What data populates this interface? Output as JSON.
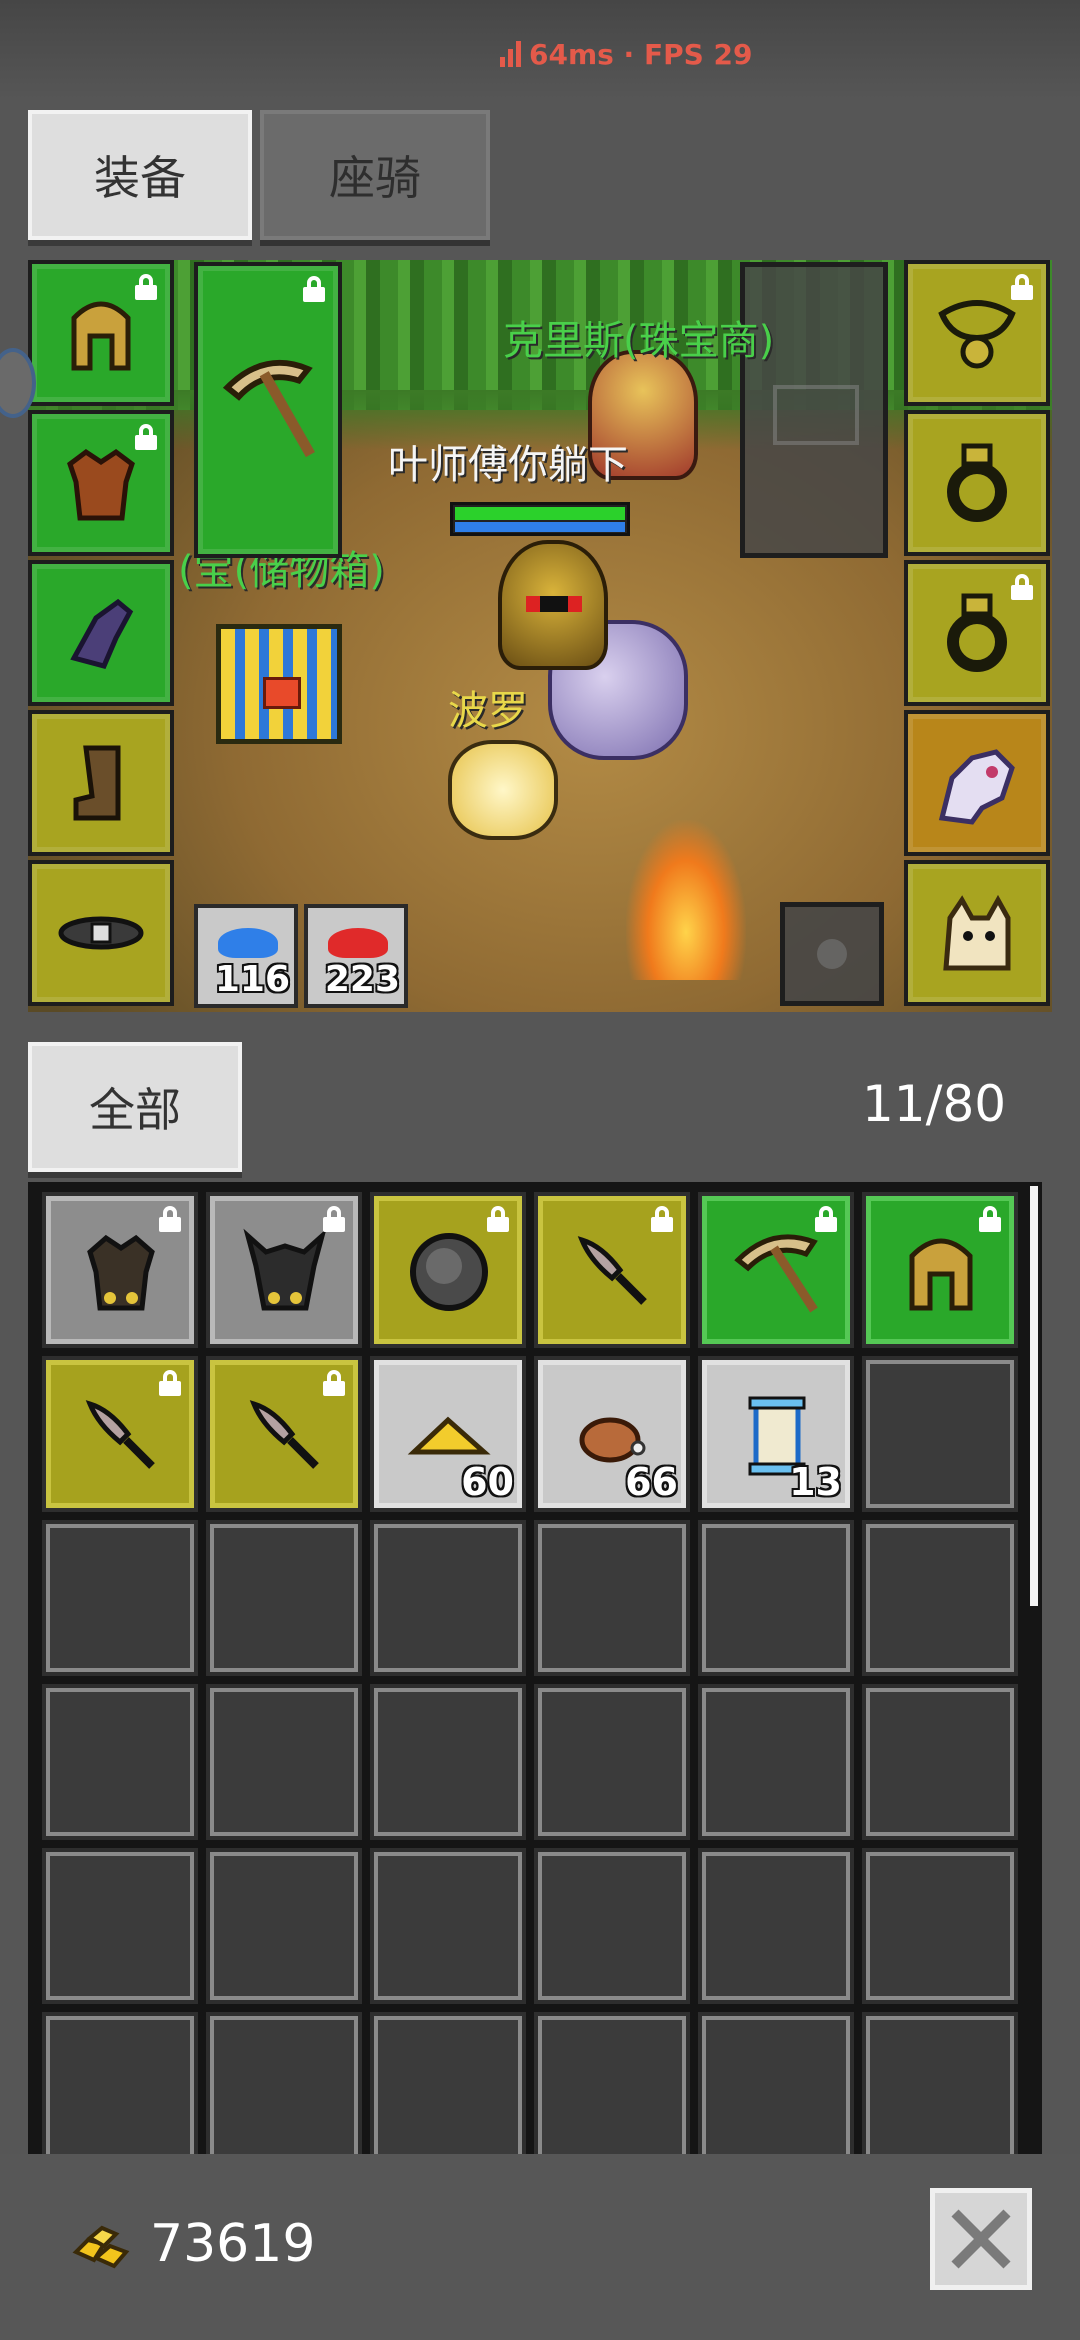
{
  "status_bar": {
    "network_label": "64ms · FPS 29"
  },
  "tabs": [
    {
      "label": "装备",
      "active": true
    },
    {
      "label": "座骑",
      "active": false
    }
  ],
  "scene": {
    "npc_name": "克里斯(珠宝商)",
    "chat_text": "叶师傅你躺下",
    "pet_name": "波罗",
    "chest_name": "(宝(储物箱)"
  },
  "equipment": {
    "left": [
      {
        "icon": "helmet-icon",
        "rarity": "green",
        "locked": true
      },
      {
        "icon": "armor-icon",
        "rarity": "green",
        "locked": true
      },
      {
        "icon": "glove-icon",
        "rarity": "green",
        "locked": false
      },
      {
        "icon": "boots-icon",
        "rarity": "olive",
        "locked": false
      },
      {
        "icon": "belt-icon",
        "rarity": "olive",
        "locked": false
      }
    ],
    "weapon": {
      "icon": "pickaxe-icon",
      "rarity": "green",
      "locked": true
    },
    "right": [
      {
        "icon": "necklace-icon",
        "rarity": "olive",
        "locked": true
      },
      {
        "icon": "ring-icon",
        "rarity": "olive",
        "locked": false
      },
      {
        "icon": "ring-icon",
        "rarity": "olive",
        "locked": true
      },
      {
        "icon": "mount-icon",
        "rarity": "orange",
        "locked": false
      },
      {
        "icon": "pet-icon",
        "rarity": "olive",
        "locked": false
      }
    ],
    "potions": [
      {
        "icon": "blue-potion-icon",
        "count": "116",
        "color": "#2f7fe8"
      },
      {
        "icon": "red-potion-icon",
        "count": "223",
        "color": "#e02a2a"
      }
    ]
  },
  "bag": {
    "filter_label": "全部",
    "capacity": "11/80",
    "items": [
      {
        "icon": "dark-armor-icon",
        "rarity": "gray",
        "locked": true,
        "count": ""
      },
      {
        "icon": "horned-armor-icon",
        "rarity": "gray",
        "locked": true,
        "count": ""
      },
      {
        "icon": "shield-icon",
        "rarity": "olive",
        "locked": true,
        "count": ""
      },
      {
        "icon": "dagger-icon",
        "rarity": "olive",
        "locked": true,
        "count": ""
      },
      {
        "icon": "pickaxe-icon",
        "rarity": "green",
        "locked": true,
        "count": ""
      },
      {
        "icon": "helmet-icon",
        "rarity": "green",
        "locked": true,
        "count": ""
      },
      {
        "icon": "dagger-icon",
        "rarity": "olive",
        "locked": true,
        "count": ""
      },
      {
        "icon": "dagger-icon",
        "rarity": "olive",
        "locked": true,
        "count": ""
      },
      {
        "icon": "cheese-icon",
        "rarity": "light",
        "locked": false,
        "count": "60"
      },
      {
        "icon": "meat-icon",
        "rarity": "light",
        "locked": false,
        "count": "66"
      },
      {
        "icon": "scroll-icon",
        "rarity": "light",
        "locked": false,
        "count": "13"
      }
    ],
    "visible_rows": 6,
    "columns": 6
  },
  "footer": {
    "gold_icon": "gold-coins-icon",
    "gold": "73619",
    "close_icon": "close-icon"
  },
  "colors": {
    "green_rarity": "#2aa82a",
    "olive_rarity": "#a8a420",
    "orange_rarity": "#b8861a",
    "gray_rarity": "#8d8d8d",
    "network_text": "#e45a4a"
  }
}
